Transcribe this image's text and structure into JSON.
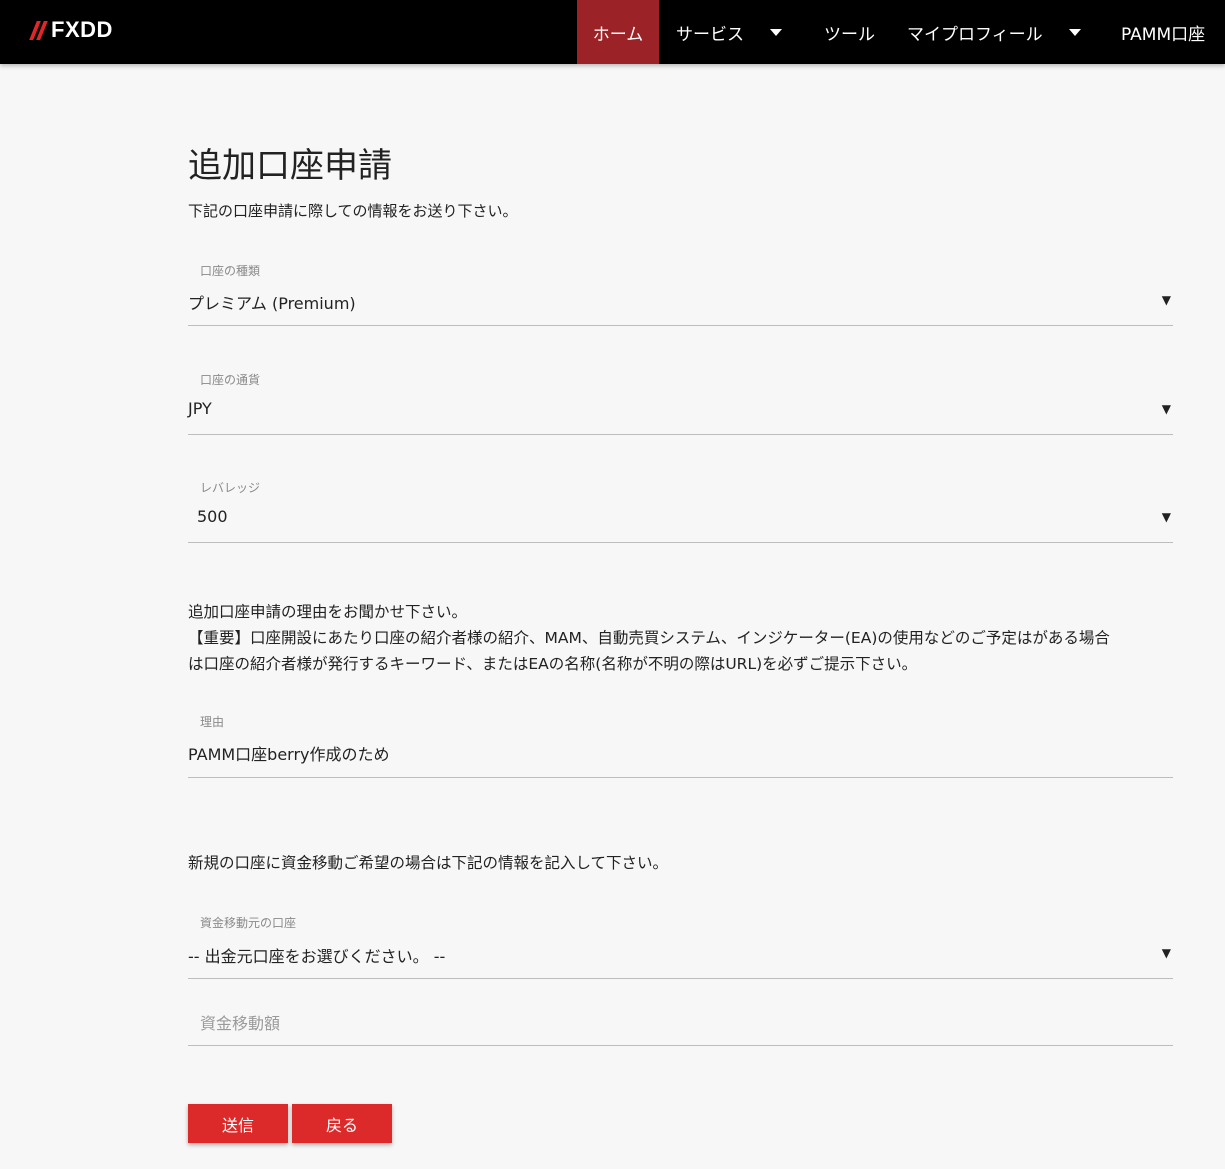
{
  "nav": {
    "logo": "FXDD",
    "items": [
      {
        "label": "ホーム",
        "active": true
      },
      {
        "label": "サービス",
        "dropdown": true
      },
      {
        "label": "ツール"
      },
      {
        "label": "マイプロフィール",
        "dropdown": true
      },
      {
        "label": "PAMM口座"
      }
    ]
  },
  "page": {
    "title": "追加口座申請",
    "subtitle": "下記の口座申請に際しての情報をお送り下さい。"
  },
  "form": {
    "account_type": {
      "label": "口座の種類",
      "value": "プレミアム (Premium)"
    },
    "currency": {
      "label": "口座の通貨",
      "value": "JPY"
    },
    "leverage": {
      "label": "レバレッジ",
      "value": "500"
    },
    "reason_info": [
      "追加口座申請の理由をお聞かせ下さい。",
      "【重要】口座開設にあたり口座の紹介者様の紹介、MAM、自動売買システム、インジケーター(EA)の使用などのご予定はがある場合",
      "は口座の紹介者様が発行するキーワード、またはEAの名称(名称が不明の際はURL)を必ずご提示下さい。"
    ],
    "reason": {
      "label": "理由",
      "value": "PAMM口座berry作成のため"
    },
    "transfer_info": "新規の口座に資金移動ご希望の場合は下記の情報を記入して下さい。",
    "transfer_source": {
      "label": "資金移動元の口座",
      "value": "-- 出金元口座をお選びください。 --"
    },
    "transfer_amount": {
      "placeholder": "資金移動額"
    },
    "submit_label": "送信",
    "back_label": "戻る"
  },
  "colors": {
    "nav_bg": "#000000",
    "nav_active": "#9b2226",
    "button": "#dc2a2a",
    "logo_accent": "#e0262a"
  },
  "icons": {
    "dropdown": "caret-down-icon",
    "select_arrow": "triangle-down-icon"
  }
}
